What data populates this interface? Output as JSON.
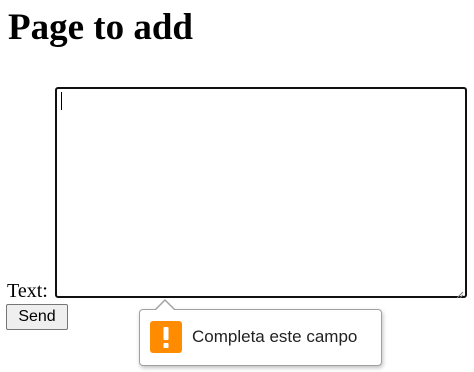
{
  "page": {
    "title": "Page to add"
  },
  "form": {
    "text_label": "Text:",
    "text_value": "",
    "send_label": "Send"
  },
  "validation_tooltip": {
    "message": "Completa este campo",
    "icon": "warning-icon",
    "icon_color": "#ff8c00"
  }
}
